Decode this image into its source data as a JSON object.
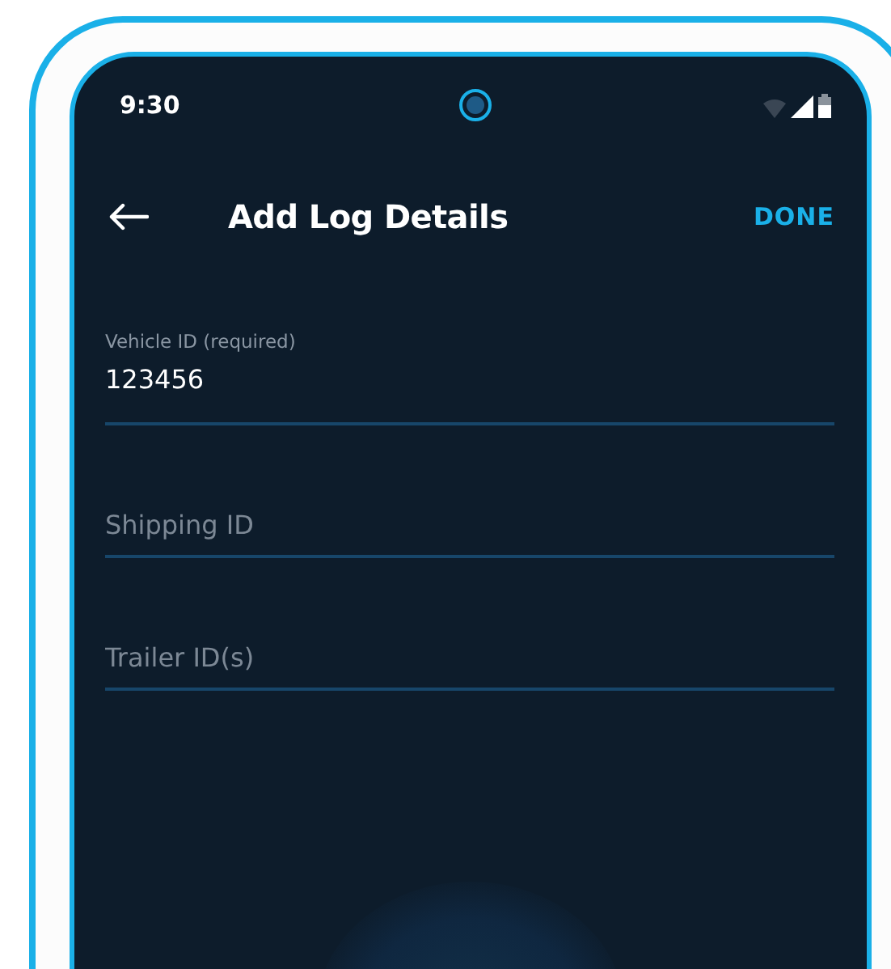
{
  "status_bar": {
    "time": "9:30"
  },
  "app_bar": {
    "title": "Add Log Details",
    "action": "DONE"
  },
  "fields": [
    {
      "kind": "filled",
      "label": "Vehicle ID (required)",
      "value": "123456"
    },
    {
      "kind": "empty",
      "placeholder": "Shipping ID"
    },
    {
      "kind": "empty",
      "placeholder": "Trailer ID(s)"
    }
  ]
}
